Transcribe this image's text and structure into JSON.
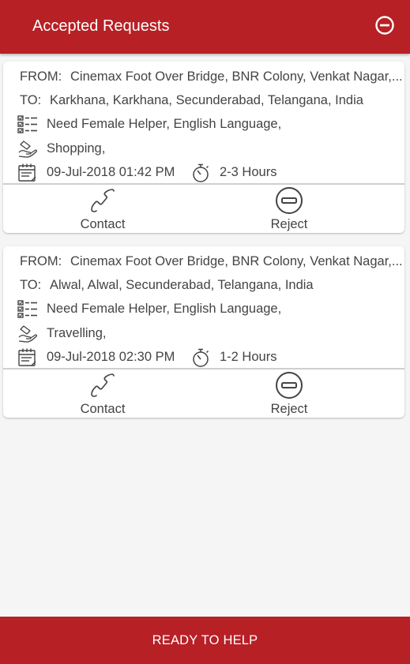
{
  "header": {
    "title": "Accepted Requests",
    "action_icon": "minus-circle-icon"
  },
  "labels": {
    "from": "FROM:",
    "to": "TO:",
    "contact": "Contact",
    "reject": "Reject"
  },
  "requests": [
    {
      "from": "Cinemax Foot Over Bridge, BNR Colony, Venkat Nagar,...",
      "to": "Karkhana, Karkhana, Secunderabad, Telangana, India",
      "needs": "Need Female Helper, English Language,",
      "task": "Shopping,",
      "datetime": "09-Jul-2018 01:42 PM",
      "duration": "2-3 Hours"
    },
    {
      "from": "Cinemax Foot Over Bridge, BNR Colony, Venkat Nagar,...",
      "to": "Alwal, Alwal, Secunderabad, Telangana, India",
      "needs": "Need Female Helper, English Language,",
      "task": "Travelling,",
      "datetime": "09-Jul-2018 02:30 PM",
      "duration": "1-2 Hours"
    }
  ],
  "footer": {
    "button_label": "READY TO HELP"
  },
  "colors": {
    "brand": "#b72025",
    "background": "#f5f5f5",
    "card": "#ffffff",
    "text": "#444444"
  }
}
